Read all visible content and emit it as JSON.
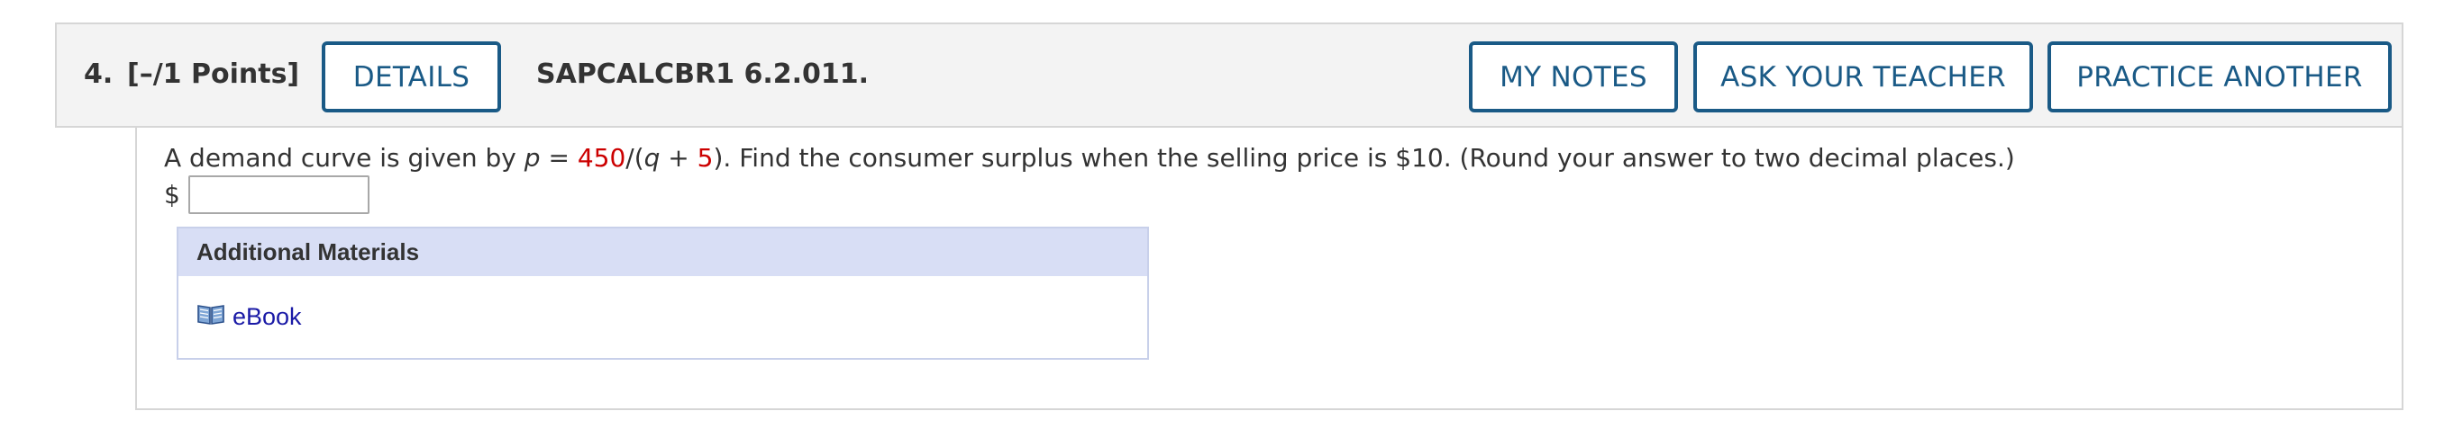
{
  "question": {
    "number": "4.",
    "points": "[–/1 Points]",
    "code": "SAPCALCBR1 6.2.011."
  },
  "buttons": {
    "details": "DETAILS",
    "my_notes": "MY NOTES",
    "ask_teacher": "ASK YOUR TEACHER",
    "practice_another": "PRACTICE ANOTHER"
  },
  "prompt": {
    "intro": "A demand curve is given by ",
    "var_p": "p",
    "equals": " = ",
    "num_450": "450",
    "slash_open": "/(",
    "var_q": "q",
    "plus": " + ",
    "num_5": "5",
    "rest": ").  Find the consumer surplus when the selling price is $10. (Round your answer to two decimal places.)"
  },
  "answer": {
    "currency_symbol": "$",
    "value": "",
    "placeholder": ""
  },
  "additional_materials": {
    "title": "Additional Materials",
    "items": [
      {
        "label": "eBook",
        "icon": "book-icon"
      }
    ]
  },
  "colors": {
    "button_border": "#1a5a86",
    "highlight_number": "#cc0000",
    "link": "#1a1aa6",
    "materials_header_bg": "#d8def5"
  }
}
